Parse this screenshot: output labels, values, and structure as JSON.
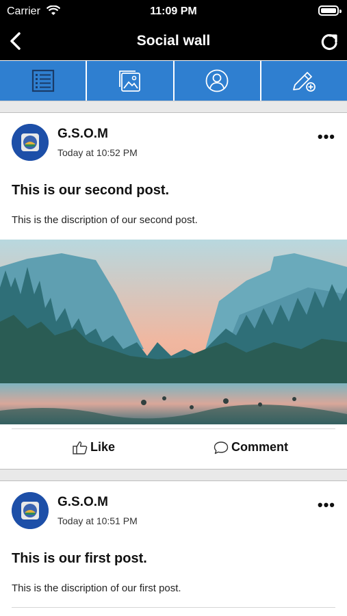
{
  "status_bar": {
    "carrier": "Carrier",
    "time": "11:09 PM"
  },
  "nav": {
    "title": "Social wall",
    "back_icon": "chevron-left-icon",
    "refresh_icon": "refresh-icon"
  },
  "tabs": [
    {
      "icon": "list-icon"
    },
    {
      "icon": "image-gallery-icon"
    },
    {
      "icon": "user-profile-icon"
    },
    {
      "icon": "compose-pencil-icon"
    }
  ],
  "colors": {
    "header_bg": "#000000",
    "tab_bg": "#2f7fd0",
    "avatar_bg": "#1d4fa8"
  },
  "posts": [
    {
      "author": "G.S.O.M",
      "time": "Today at 10:52 PM",
      "title": "This is our second post.",
      "description": "This is the discription of our second post.",
      "like_label": "Like",
      "comment_label": "Comment"
    },
    {
      "author": "G.S.O.M",
      "time": "Today at 10:51 PM",
      "title": "This is our first post.",
      "description": "This is the discription of our first post."
    }
  ]
}
